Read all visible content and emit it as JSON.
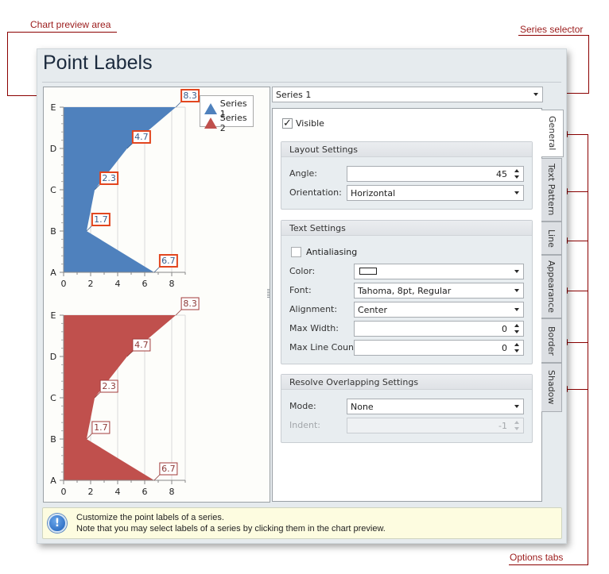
{
  "callouts": {
    "chart_preview": "Chart preview area",
    "series_selector": "Series selector",
    "options_tabs": "Options tabs"
  },
  "dialog": {
    "title": "Point Labels"
  },
  "series_selector": {
    "value": "Series 1"
  },
  "tabs": [
    {
      "label": "General",
      "active": true
    },
    {
      "label": "Text Pattern",
      "active": false
    },
    {
      "label": "Line",
      "active": false
    },
    {
      "label": "Appearance",
      "active": false
    },
    {
      "label": "Border",
      "active": false
    },
    {
      "label": "Shadow",
      "active": false
    }
  ],
  "general": {
    "visible_label": "Visible",
    "visible_checked": true,
    "layout_settings": {
      "header": "Layout Settings",
      "angle_label": "Angle:",
      "angle_value": "45",
      "orientation_label": "Orientation:",
      "orientation_value": "Horizontal"
    },
    "text_settings": {
      "header": "Text Settings",
      "antialiasing_label": "Antialiasing",
      "antialiasing_checked": false,
      "color_label": "Color:",
      "color_value": "#ffffff",
      "font_label": "Font:",
      "font_value": "Tahoma, 8pt, Regular",
      "alignment_label": "Alignment:",
      "alignment_value": "Center",
      "max_width_label": "Max Width:",
      "max_width_value": "0",
      "max_line_count_label": "Max Line Count:",
      "max_line_count_value": "0"
    },
    "resolve_overlapping": {
      "header": "Resolve Overlapping Settings",
      "mode_label": "Mode:",
      "mode_value": "None",
      "indent_label": "Indent:",
      "indent_value": "-1"
    }
  },
  "info": {
    "icon": "info-exclamation-icon",
    "line1": "Customize the point labels of a series.",
    "line2": "Note that you may select labels of a series by clicking them in the chart preview."
  },
  "chart_data": [
    {
      "type": "area",
      "orientation": "horizontal",
      "title": "",
      "categories": [
        "A",
        "B",
        "C",
        "D",
        "E"
      ],
      "series": [
        {
          "name": "Series 1",
          "values": [
            6.7,
            1.7,
            2.3,
            4.7,
            8.3
          ],
          "color": "#4f81bd",
          "label_border": "#e2461f",
          "label_text": "#3b5e8c"
        }
      ],
      "xlim": [
        0,
        9
      ],
      "xticks": [
        0,
        2,
        4,
        6,
        8
      ],
      "grid": true,
      "legend": {
        "position": "top-right",
        "entries": [
          "Series 1",
          "Series 2"
        ],
        "colors": [
          "#4f81bd",
          "#c0504d"
        ]
      }
    },
    {
      "type": "area",
      "orientation": "horizontal",
      "title": "",
      "categories": [
        "A",
        "B",
        "C",
        "D",
        "E"
      ],
      "series": [
        {
          "name": "Series 2",
          "values": [
            6.7,
            1.7,
            2.3,
            4.7,
            8.3
          ],
          "color": "#c0504d",
          "label_border": "#a23b3b",
          "label_text": "#8c3a38"
        }
      ],
      "xlim": [
        0,
        9
      ],
      "xticks": [
        0,
        2,
        4,
        6,
        8
      ],
      "grid": true
    }
  ]
}
